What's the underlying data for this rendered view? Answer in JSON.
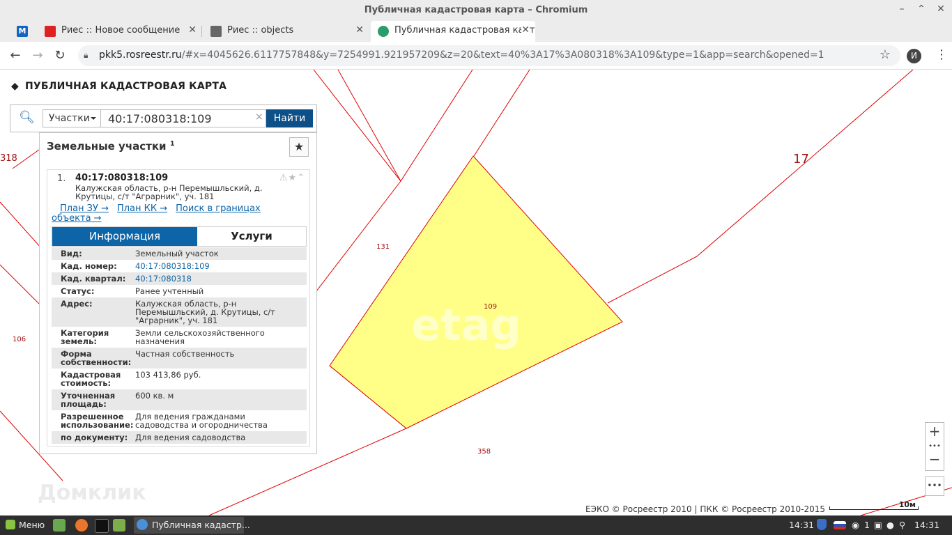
{
  "window": {
    "title": "Публичная кадастровая карта – Chromium",
    "minimize": "–",
    "restore": "⌃",
    "close": "✕"
  },
  "tabs": [
    {
      "label": "Риес :: Новое сообщение",
      "favicon_color": "#dd2222"
    },
    {
      "label": "Риес :: objects",
      "favicon_color": "#555555"
    },
    {
      "label": "Публичная кадастровая карт",
      "favicon_color": "#2a9d6a",
      "active": true
    }
  ],
  "tab_leading_icon": "M",
  "address_bar": {
    "domain": "pkk5.rosreestr.ru",
    "path": "/#x=4045626.6117757848&y=7254991.921957209&z=20&text=40%3A17%3A080318%3A109&type=1&app=search&opened=1"
  },
  "profile_initial": "И",
  "app": {
    "title": "ПУБЛИЧНАЯ КАДАСТРОВАЯ КАРТА",
    "logo_icon": "pkk-logo-icon"
  },
  "search": {
    "type_label": "Участки",
    "query": "40:17:080318:109",
    "clear": "×",
    "find_label": "Найти"
  },
  "results": {
    "header": "Земельные участки",
    "count": "1",
    "item": {
      "number": "1.",
      "cad_number": "40:17:080318:109",
      "address": "Калужская область, р-н Перемышльский, д. Крутицы, с/т \"Аграрник\", уч. 181",
      "links": [
        "План ЗУ →",
        "План КК →",
        "Поиск в границах объекта →"
      ],
      "tab_info": "Информация",
      "tab_services": "Услуги",
      "rows": [
        {
          "k": "Вид:",
          "v": "Земельный участок"
        },
        {
          "k": "Кад. номер:",
          "v": "40:17:080318:109",
          "link": true
        },
        {
          "k": "Кад. квартал:",
          "v": "40:17:080318",
          "link": true
        },
        {
          "k": "Статус:",
          "v": "Ранее учтенный"
        },
        {
          "k": "Адрес:",
          "v": "Калужская область, р-н Перемышльский, д. Крутицы, с/т \"Аграрник\", уч. 181"
        },
        {
          "k": "Категория земель:",
          "v": "Земли сельскохозяйственного назначения"
        },
        {
          "k": "Форма собственности:",
          "v": "Частная собственность"
        },
        {
          "k": "Кадастровая стоимость:",
          "v": "103 413,86 руб."
        },
        {
          "k": "Уточненная площадь:",
          "v": "600 кв. м"
        },
        {
          "k": "Разрешенное использование:",
          "v": "Для ведения гражданами садоводства и огородничества"
        },
        {
          "k": "по документу:",
          "v": "Для ведения садоводства"
        }
      ]
    }
  },
  "map": {
    "labels": {
      "l318": "318",
      "l17": "17",
      "l131": "131",
      "l109": "109",
      "l106": "106",
      "l358": "358"
    },
    "parcel_fill": "#ffff88",
    "line_color": "#e00000",
    "watermark": "Домклик",
    "watermark2": "etag",
    "credit": "ЕЭКО © Росреестр 2010 | ПКК © Росреестр 2010-2015",
    "scale": "10м"
  },
  "taskbar": {
    "menu": "Меню",
    "window_label": "Публичная кадастр...",
    "clock_left": "14:31",
    "count": "1",
    "clock_right": "14:31"
  }
}
